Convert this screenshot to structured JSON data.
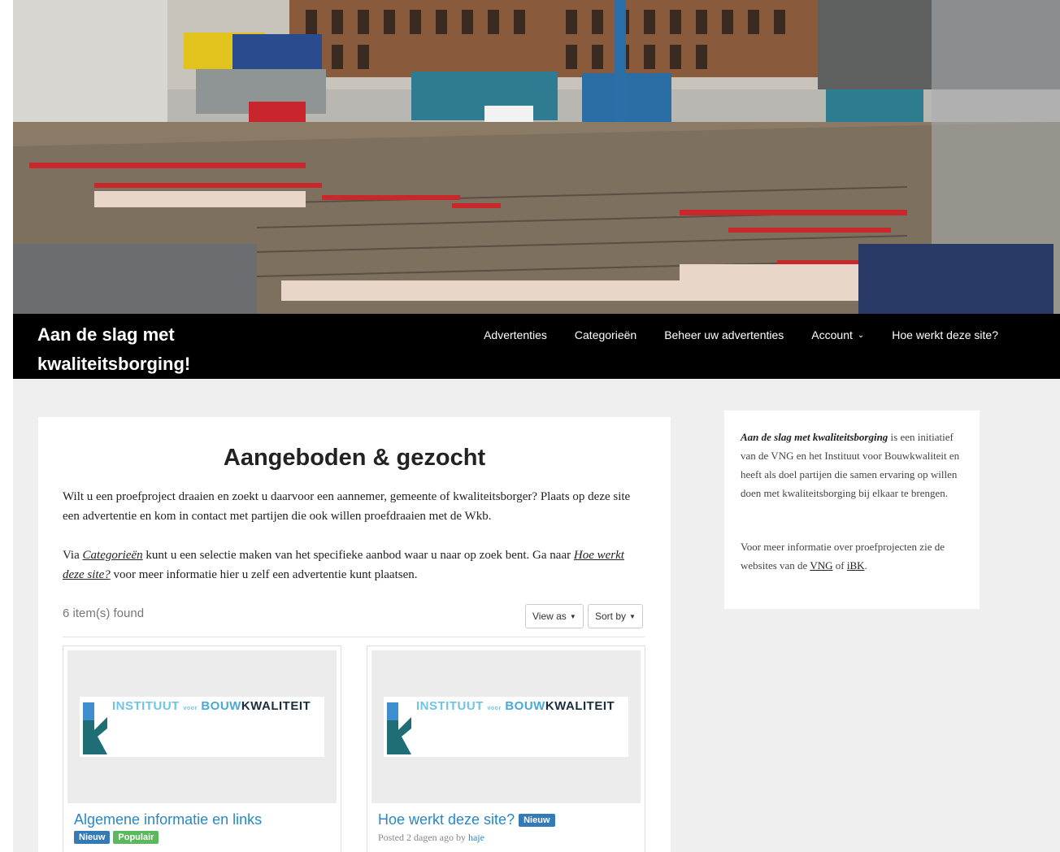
{
  "site": {
    "title": "Aan de slag met kwaliteitsborging!"
  },
  "nav": {
    "items": [
      {
        "label": "Advertenties"
      },
      {
        "label": "Categorieën"
      },
      {
        "label": "Beheer uw advertenties"
      },
      {
        "label": "Account"
      },
      {
        "label": "Hoe werkt deze site?"
      }
    ]
  },
  "main": {
    "title": "Aangeboden & gezocht",
    "intro": "Wilt u een proefproject draaien en zoekt u daarvoor een aannemer, gemeente of kwaliteitsborger? Plaats op deze site een advertentie en kom in contact met partijen die ook willen proefdraaien met de Wkb.",
    "via_prefix": "Via ",
    "via_link1": "Categorieën",
    "via_middle": " kunt u een selectie maken van het specifieke aanbod waar u naar op zoek bent.  Ga naar ",
    "via_link2": "Hoe werkt deze site?",
    "via_suffix": " voor meer informatie hier u zelf een advertentie kunt plaatsen.",
    "found": "6 item(s) found",
    "view_as": "View as",
    "sort_by": "Sort by"
  },
  "logo": {
    "part1": "INSTITUUT",
    "part2": "voor",
    "part3": "BOUW",
    "part4": "KWALITEIT"
  },
  "listings": [
    {
      "title": "Algemene informatie en links",
      "badges": [
        "Nieuw",
        "Populair"
      ]
    },
    {
      "title": "Hoe werkt deze site?",
      "badge": "Nieuw",
      "posted_prefix": "Posted 2 dagen ago by ",
      "author": "haje"
    }
  ],
  "sidebar": {
    "p1_bold": "Aan de slag met kwaliteitsborging",
    "p1_rest": " is een initiatief van de VNG en het Instituut voor Bouwkwaliteit en heeft als doel partijen die samen ervaring op willen doen met kwaliteitsborging bij elkaar te brengen.",
    "p2_prefix": "Voor meer informatie over proefprojecten zie de websites van de ",
    "p2_link1": "VNG",
    "p2_mid": " of ",
    "p2_link2": "iBK",
    "p2_suffix": "."
  },
  "colors": {
    "link": "#2a87c6",
    "badge_new": "#337ab7",
    "badge_popular": "#5cb85c",
    "nav_bg": "#000000"
  },
  "icons": {
    "account_dropdown": "chevron-down-icon",
    "view_caret": "caret-down-icon",
    "sort_caret": "caret-down-icon"
  }
}
